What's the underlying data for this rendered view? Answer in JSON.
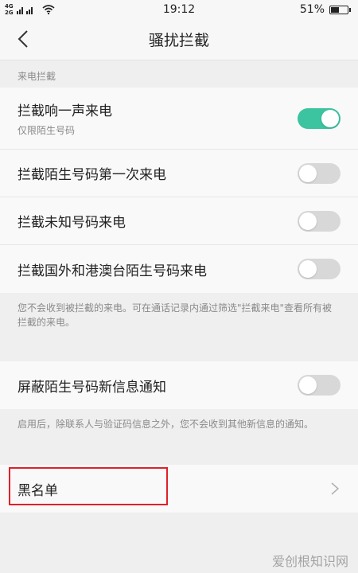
{
  "status": {
    "net_top": "4G",
    "net_bottom": "2G",
    "time": "19:12",
    "battery": "51%",
    "battery_level": 0.51
  },
  "header": {
    "title": "骚扰拦截"
  },
  "call_section": {
    "header": "来电拦截",
    "items": [
      {
        "label": "拦截响一声来电",
        "sub": "仅限陌生号码",
        "on": true
      },
      {
        "label": "拦截陌生号码第一次来电",
        "on": false
      },
      {
        "label": "拦截未知号码来电",
        "on": false
      },
      {
        "label": "拦截国外和港澳台陌生号码来电",
        "on": false
      }
    ],
    "note": "您不会收到被拦截的来电。可在通话记录内通过筛选\"拦截来电\"查看所有被拦截的来电。"
  },
  "sms_section": {
    "item": {
      "label": "屏蔽陌生号码新信息通知",
      "on": false
    },
    "note": "启用后，除联系人与验证码信息之外，您不会收到其他新信息的通知。"
  },
  "blacklist": {
    "label": "黑名单"
  },
  "colors": {
    "toggle_on": "#3cc3a0",
    "toggle_off": "#d8d8d8",
    "highlight": "#e0202a"
  },
  "watermark": "爱创根知识网"
}
